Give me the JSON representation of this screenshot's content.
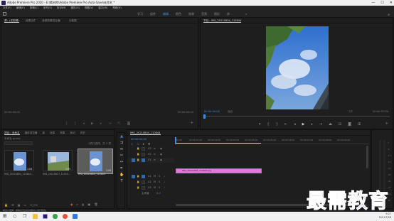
{
  "window": {
    "title": "Adobe Premiere Pro 2020 - E:\\素材库\\Adobe Premiere Pro Auto-Save\\未命名 *",
    "minimize": "—",
    "maximize": "☐",
    "close": "✕"
  },
  "menu": [
    "文件(F)",
    "编辑(E)",
    "剪辑(C)",
    "序列(S)",
    "标记(M)",
    "图形(G)",
    "视图(V)",
    "窗口(W)",
    "帮助(H)"
  ],
  "workspaces": {
    "tabs": [
      "学习",
      "组件",
      "编辑",
      "颜色",
      "效果",
      "音频",
      "图形",
      "库"
    ],
    "active_index": 2,
    "more": "»"
  },
  "source_monitor": {
    "tabs": [
      "源：(无剪辑)",
      "效果控件",
      "音频剪辑混合器：",
      "元数据"
    ],
    "timecode_left": "00:00:00:00",
    "timecode_right": "00:00:00:00"
  },
  "program_monitor": {
    "tab": "节目：IMG_20210804_110844",
    "timecode": "00:00:00:00",
    "fit": "适合",
    "duration": "00:00:01:04",
    "scale": "1/2"
  },
  "project": {
    "tabs": [
      "项目：未命名",
      "媒体浏览器",
      "库",
      "信息",
      "效果",
      "标记",
      "历史"
    ],
    "file_name": "未命名.prproj",
    "items_info": "1项已选择，共 3 项",
    "clips": [
      {
        "name": "IMG_20210804_110844...",
        "duration": "1:04"
      },
      {
        "name": "IMG_20210817_12335...",
        "duration": "1:05"
      },
      {
        "name": "IMG_20210804_110844",
        "duration": "1:04"
      }
    ]
  },
  "timeline": {
    "tab": "IMG_20210804_110844",
    "timecode": "00:00:00:00",
    "ruler_labels": [
      "00:00",
      "00:00:01:00",
      "00:00:02:00",
      "00:00:03:00",
      "00:00:04:00",
      "00:00:05:00",
      "00:00:06:00",
      "00:00:07:00",
      "00:00:08:00",
      "00:00:09:00"
    ],
    "video_tracks": [
      "V3",
      "V2",
      "V1"
    ],
    "audio_tracks": [
      "A1",
      "A2",
      "A3"
    ],
    "master": "主声道",
    "master_value": "0.0",
    "clip_label": "IMG_20210804_110844.jpg",
    "clip_color": "#e27bd7"
  },
  "status_bar": "单击以选择，或单击空白处并拖动以进行框选。",
  "taskbar": {
    "time": "9:27",
    "date": "2021/7/28"
  },
  "watermark": "最需教育",
  "colors": {
    "accent": "#3b8fe8",
    "clip": "#e27bd7",
    "playhead": "#e8e336"
  }
}
